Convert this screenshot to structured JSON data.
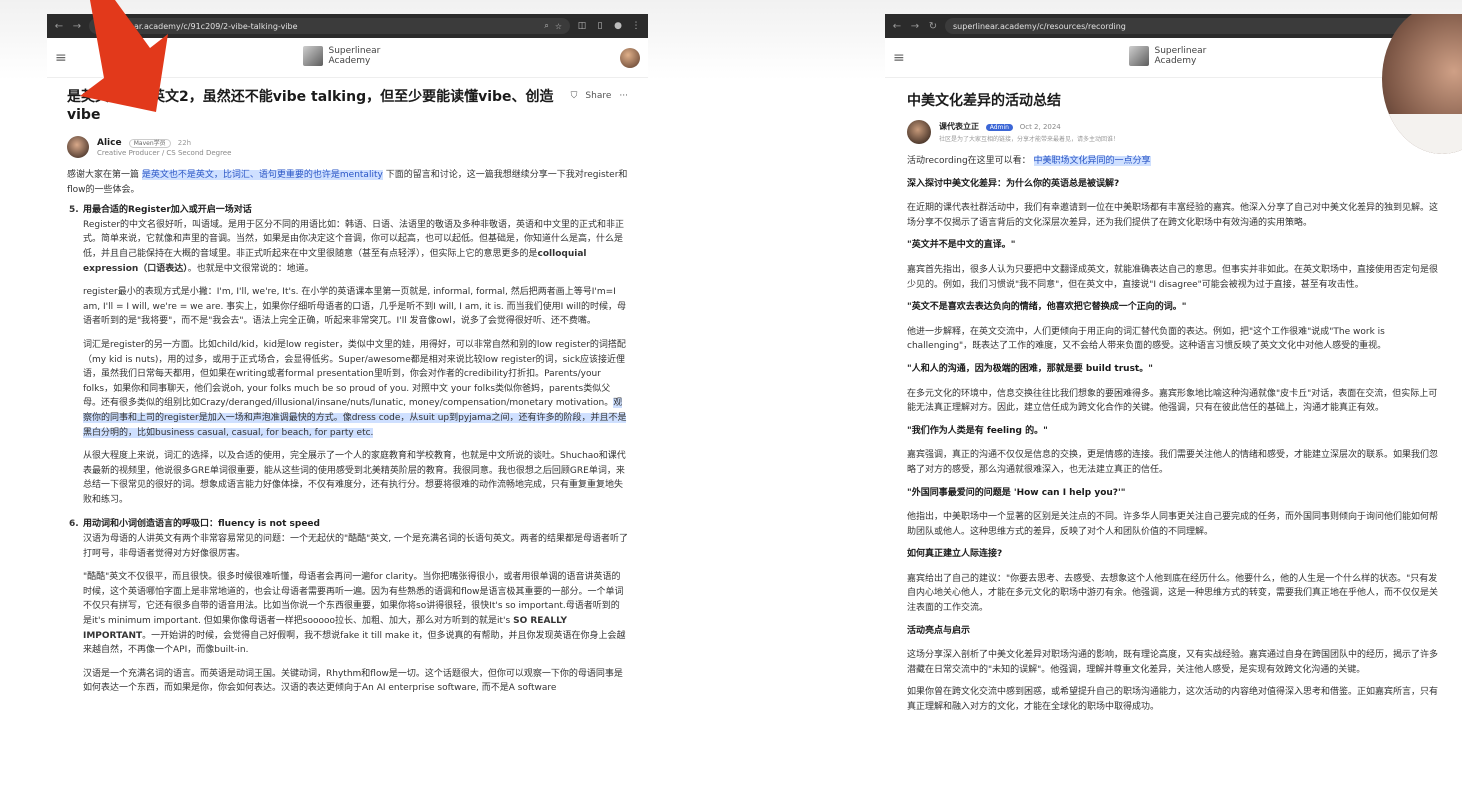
{
  "left": {
    "url": "superlinear.academy/c/91c209/2-vibe-talking-vibe",
    "brand": "Superlinear Academy",
    "post": {
      "title": "是英文也不是英文2，虽然还不能vibe talking，但至少要能读懂vibe、创造vibe",
      "share_label": "Share",
      "more_label": "···",
      "author": {
        "name": "Alice",
        "badge": "Maven学员",
        "time": "22h",
        "role": "Creative Producer / CS Second Degree"
      },
      "intro": {
        "prefix": "感谢大家在第一篇",
        "link": "是英文也不是英文，比词汇、语句更重要的也许是mentality",
        "suffix": "下面的留言和讨论，这一篇我想继续分享一下我对register和flow的一些体会。"
      },
      "items": [
        {
          "num": "5.",
          "heading": "用最合适的Register加入或开启一场对话",
          "paragraphs": [
            {
              "text": "Register的中文名很好听，叫语域。是用于区分不同的用语比如：韩语、日语、法语里的敬语及多种非敬语，英语和中文里的正式和非正式。简单来说，它就像和声里的音调。当然，如果是由你决定这个音调，你可以起高，也可以起低。但基础是，你知道什么是高，什么是低，并且自己能保持在大概的音域里。非正式听起来在中文里很随意（甚至有点轻浮），但实际上它的意思更多的是",
              "bold": "colloquial expression（口语表达）",
              "tail": "。也就是中文很常说的：地道。"
            },
            {
              "text": "register最小的表现方式是小撇：I'm, I'll, we're, It's. 在小学的英语课本里第一页就是, informal, formal, 然后把两者画上等号I'm=I am, I'll = I will, we're = we are. 事实上，如果你仔细听母语者的口语，几乎是听不到I will, I am, it is. 而当我们使用I will的时候，母语者听到的是\"我将要\"，而不是\"我会去\"。语法上完全正确，听起来非常突兀。I'll 发音像owl，说多了会觉得很好听、还不费嘴。"
            },
            {
              "text": "词汇是register的另一方面。比如child/kid，kid是low register，类似中文里的娃，用得好，可以非常自然和别的low register的词搭配（my kid is nuts)，用的过多，或用于正式场合，会显得低劣。Super/awesome都是相对来说比较low register的词，sick应该接近俚语，虽然我们日常每天都用，但如果在writing或者formal presentation里听到，你会对作者的credibility打折扣。Parents/your folks，如果你和同事聊天，他们会说oh, your folks much be so proud of you. 对照中文 your folks类似你爸妈，parents类似父母。还有很多类似的组别比如Crazy/deranged/illusional/insane/nuts/lunatic, money/compensation/monetary motivation。",
              "highlight": "观察你的同事和上司的register是加入一场和声泡准调最快的方式。像dress code，从suit up到pyjama之间，还有许多的阶段，并且不是黑白分明的，比如business casual, casual, for beach, for party etc."
            },
            {
              "text": "从很大程度上来说，词汇的选择，以及合适的使用，完全展示了一个人的家庭教育和学校教育，也就是中文所说的谈吐。Shuchao和课代表最新的视频里，他说很多GRE单词很重要，能从这些词的使用感受到北美精英阶层的教育。我很同意。我也很想之后回顾GRE单词，来总结一下很常见的很好的词。想象成语言能力好像体操，不仅有难度分，还有执行分。想要将很难的动作流畅地完成，只有重复重复地失败和练习。"
            }
          ]
        },
        {
          "num": "6.",
          "heading": "用动词和小词创造语言的呼吸口：fluency is not speed",
          "paragraphs": [
            {
              "text": "汉语为母语的人讲英文有两个非常容易常见的问题：一个无起伏的\"酷酷\"英文, 一个是充满名词的长语句英文。两者的结果都是母语者听了打呵号，非母语者觉得对方好像很厉害。"
            },
            {
              "text": "\"酷酷\"英文不仅很平，而且很快。很多时候很难听懂，母语者会再问一遍for clarity。当你把嘴张得很小，或者用很单调的语音讲英语的时候，这个英语哪怕字面上是非常地道的，也会让母语者需要再听一遍。因为有些熟悉的语调和flow是语言极其重要的一部分。一个单词不仅只有拼写，它还有很多自带的语音用法。比如当你说一个东西很重要，如果你将so讲得很轻，很快It's so important.母语者听到的是it's minimum important. 但如果你像母语者一样把sooooo拉长、加粗、加大，那么对方听到的就是it's ",
              "bold": "SO REALLY IMPORTANT",
              "tail": "。一开始讲的时候，会觉得自己好假啊，我不想说fake it till make it，但多说真的有帮助，并且你发现英语在你身上会越来越自然，不再像一个API，而像built-in."
            },
            {
              "text": "汉语是一个充满名词的语言。而英语是动词王国。关键动词，Rhythm和flow是一切。这个话题很大，但你可以观察一下你的母语同事是如何表达一个东西，而如果是你，你会如何表达。汉语的表达更倾向于An AI enterprise software, 而不是A software"
            }
          ]
        }
      ]
    }
  },
  "right": {
    "url": "superlinear.academy/c/resources/recording",
    "brand": "Superlinear Academy",
    "title": "中美文化差异的活动总结",
    "author": {
      "name": "课代表立正",
      "badge": "Admin",
      "date": "Oct 2, 2024",
      "desc": "社区是为了大家互相的链接，分享才能带来最着见，请多主动回谁！"
    },
    "recording": {
      "prefix": "活动recording在这里可以看：",
      "link": "中美职场文化异同的一点分享"
    },
    "sections": [
      {
        "type": "h",
        "text": "深入探讨中美文化差异：为什么你的英语总是被误解?"
      },
      {
        "type": "p",
        "text": "在近期的课代表社群活动中，我们有幸邀请到一位在中美职场都有丰富经验的嘉宾。他深入分享了自己对中美文化差异的独到见解。这场分享不仅揭示了语言背后的文化深层次差异，还为我们提供了在跨文化职场中有效沟通的实用策略。"
      },
      {
        "type": "h",
        "text": "\"英文并不是中文的直译。\""
      },
      {
        "type": "p",
        "text": "嘉宾首先指出，很多人认为只要把中文翻译成英文，就能准确表达自己的意思。但事实并非如此。在英文职场中，直接使用否定句是很少见的。例如，我们习惯说\"我不同意\"，但在英文中，直接说\"I disagree\"可能会被视为过于直接，甚至有攻击性。"
      },
      {
        "type": "h",
        "text": "\"英文不是喜欢去表达负向的情绪，他喜欢把它替换成一个正向的词。\""
      },
      {
        "type": "p",
        "text": "他进一步解释，在英文交流中，人们更倾向于用正向的词汇替代负面的表达。例如，把\"这个工作很难\"说成\"The work is challenging\"，既表达了工作的难度，又不会给人带来负面的感受。这种语言习惯反映了英文文化中对他人感受的重视。"
      },
      {
        "type": "h",
        "text": "\"人和人的沟通，因为极端的困难，那就是要 build trust。\""
      },
      {
        "type": "p",
        "text": "在多元文化的环境中，信息交换往往比我们想象的要困难得多。嘉宾形象地比喻这种沟通就像\"皮卡丘\"对话，表面在交流，但实际上可能无法真正理解对方。因此，建立信任成为跨文化合作的关键。他强调，只有在彼此信任的基础上，沟通才能真正有效。"
      },
      {
        "type": "h",
        "text": "\"我们作为人类是有 feeling 的。\""
      },
      {
        "type": "p",
        "text": "嘉宾强调，真正的沟通不仅仅是信息的交换，更是情感的连接。我们需要关注他人的情绪和感受，才能建立深层次的联系。如果我们忽略了对方的感受，那么沟通就很难深入，也无法建立真正的信任。"
      },
      {
        "type": "h",
        "text": "\"外国同事最爱问的问题是 'How can I help you?'\""
      },
      {
        "type": "p",
        "text": "他指出，中美职场中一个显著的区别是关注点的不同。许多华人同事更关注自己要完成的任务，而外国同事则倾向于询问他们能如何帮助团队或他人。这种思维方式的差异，反映了对个人和团队价值的不同理解。"
      },
      {
        "type": "h",
        "text": "如何真正建立人际连接?"
      },
      {
        "type": "p",
        "text": "嘉宾给出了自己的建议：\"你要去思考、去感受、去想象这个人他到底在经历什么。他要什么，他的人生是一个什么样的状态。\"只有发自内心地关心他人，才能在多元文化的职场中游刃有余。他强调，这是一种思维方式的转变，需要我们真正地在乎他人，而不仅仅是关注表面的工作交流。"
      },
      {
        "type": "h",
        "text": "活动亮点与启示"
      },
      {
        "type": "p",
        "text": "这场分享深入剖析了中美文化差异对职场沟通的影响，既有理论高度，又有实战经验。嘉宾通过自身在跨国团队中的经历，揭示了许多潜藏在日常交流中的\"未知的误解\"。他强调，理解并尊重文化差异，关注他人感受，是实现有效跨文化沟通的关键。"
      },
      {
        "type": "p",
        "text": "如果你曾在跨文化交流中感到困惑，或希望提升自己的职场沟通能力，这次活动的内容绝对值得深入思考和借鉴。正如嘉宾所言，只有真正理解和融入对方的文化，才能在全球化的职场中取得成功。"
      }
    ]
  },
  "colors": {
    "highlight_bg": "#cfe0ff",
    "link": "#2a56c6",
    "arrow": "#e2391b",
    "admin_badge": "#3b66d6",
    "chrome": "#2b2b2b"
  }
}
